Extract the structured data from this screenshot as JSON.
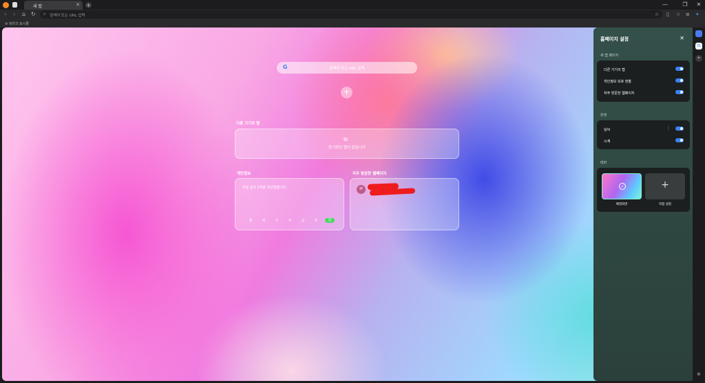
{
  "tab": {
    "title": "새 탭",
    "close": "✕"
  },
  "window": {
    "minimize": "—",
    "restore": "❐",
    "close": "✕"
  },
  "omnibox": {
    "placeholder": "검색어 또는 URL 입력"
  },
  "bookmarks_bar": {
    "label": "북마크 표시줄"
  },
  "newtab": {
    "search_placeholder": "검색어 또는 URL 입력",
    "add_shortcut": "+",
    "devices": {
      "heading": "다른 기기의 탭",
      "empty": "동기화된 탭이 없습니다"
    },
    "privacy": {
      "heading": "개인정보",
      "summary": "오늘 광고 0개를 차단했습니다.",
      "days": [
        "월",
        "화",
        "수",
        "목",
        "금",
        "토",
        "일"
      ],
      "active_day_index": 6
    },
    "frequent": {
      "heading": "자주 방문한 웹페이지",
      "badge": "IP"
    }
  },
  "panel": {
    "title": "홈페이지 설정",
    "close": "✕",
    "newtab_section": "새 탭 페이지",
    "newtab_items": [
      {
        "label": "다른 기기의 탭",
        "on": true
      },
      {
        "label": "개인정보 보호 현황",
        "on": true
      },
      {
        "label": "자주 방문한 웹페이지",
        "on": true
      }
    ],
    "widgets_section": "위젯",
    "widgets": [
      {
        "label": "날씨",
        "on": true
      },
      {
        "label": "시계",
        "on": true
      }
    ],
    "theme_section": "테마",
    "themes": [
      {
        "label": "배경화면",
        "selected": true
      },
      {
        "label": "직접 설정",
        "selected": false
      }
    ]
  },
  "sidebar": {
    "calendar_day": "31",
    "add": "+",
    "settings": "⚙"
  }
}
